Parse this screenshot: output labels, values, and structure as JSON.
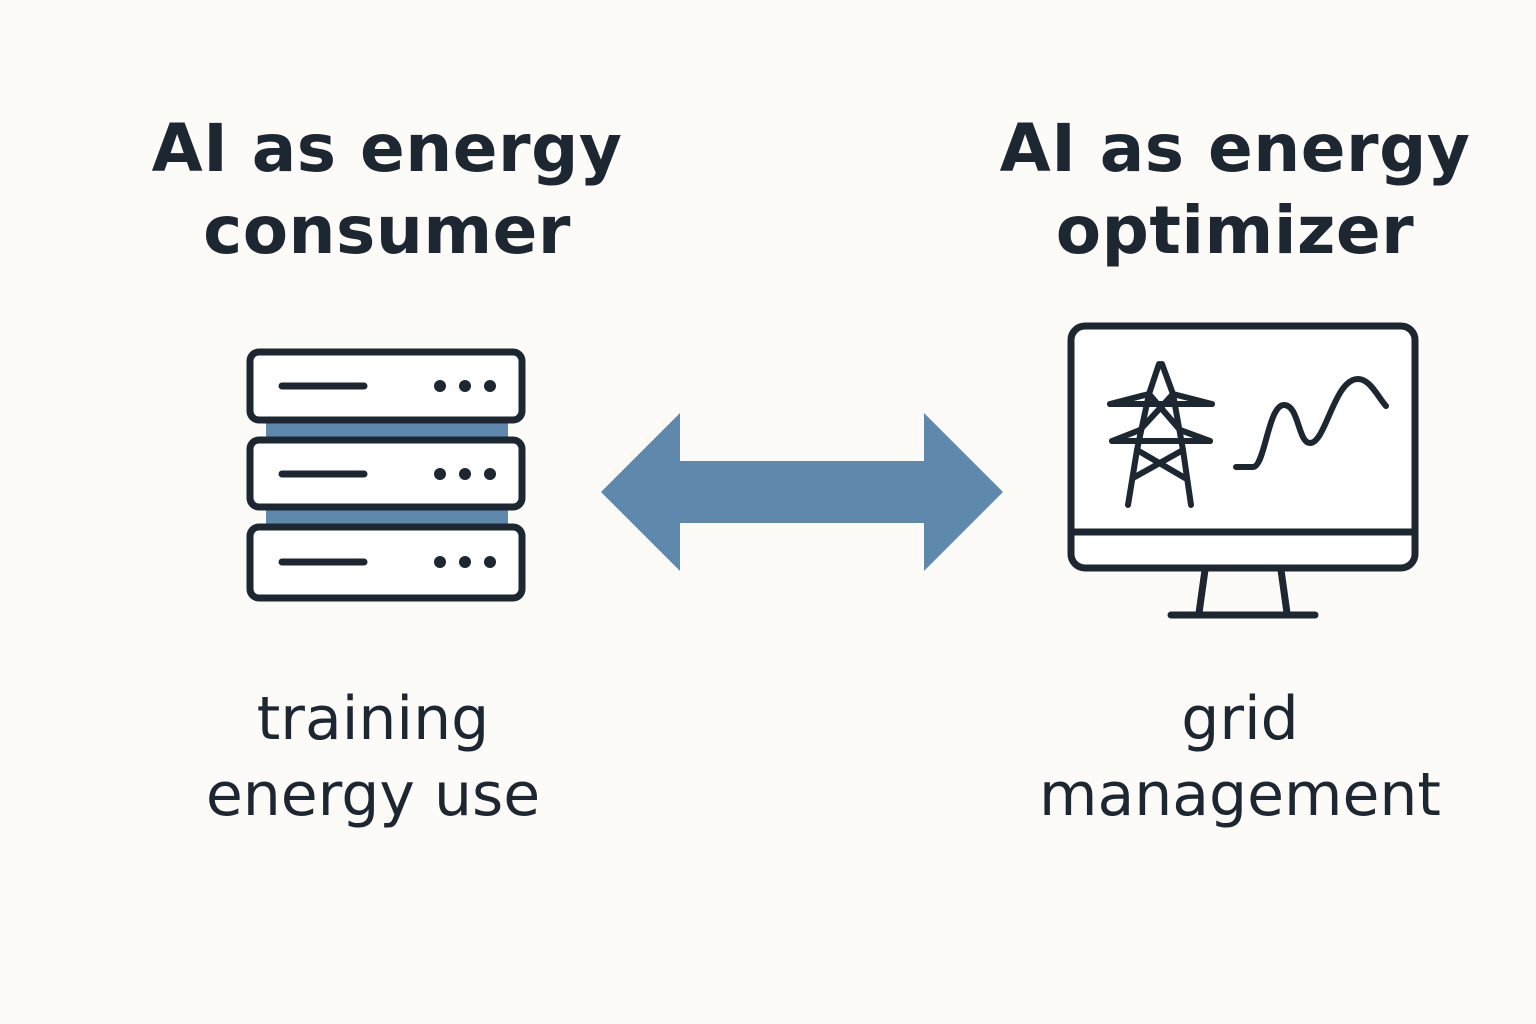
{
  "colors": {
    "background": "#fcfbf8",
    "ink": "#1d2731",
    "accent": "#5f88ad",
    "screen_fill": "#ffffff"
  },
  "left": {
    "heading_line1": "AI as energy",
    "heading_line2": "consumer",
    "icon": "server-rack-icon",
    "caption_line1": "training",
    "caption_line2": "energy use"
  },
  "right": {
    "heading_line1": "AI as energy",
    "heading_line2": "optimizer",
    "icon": "monitor-icon",
    "caption_line1": "grid",
    "caption_line2": "management"
  },
  "connector": {
    "icon": "double-headed-arrow-icon"
  }
}
